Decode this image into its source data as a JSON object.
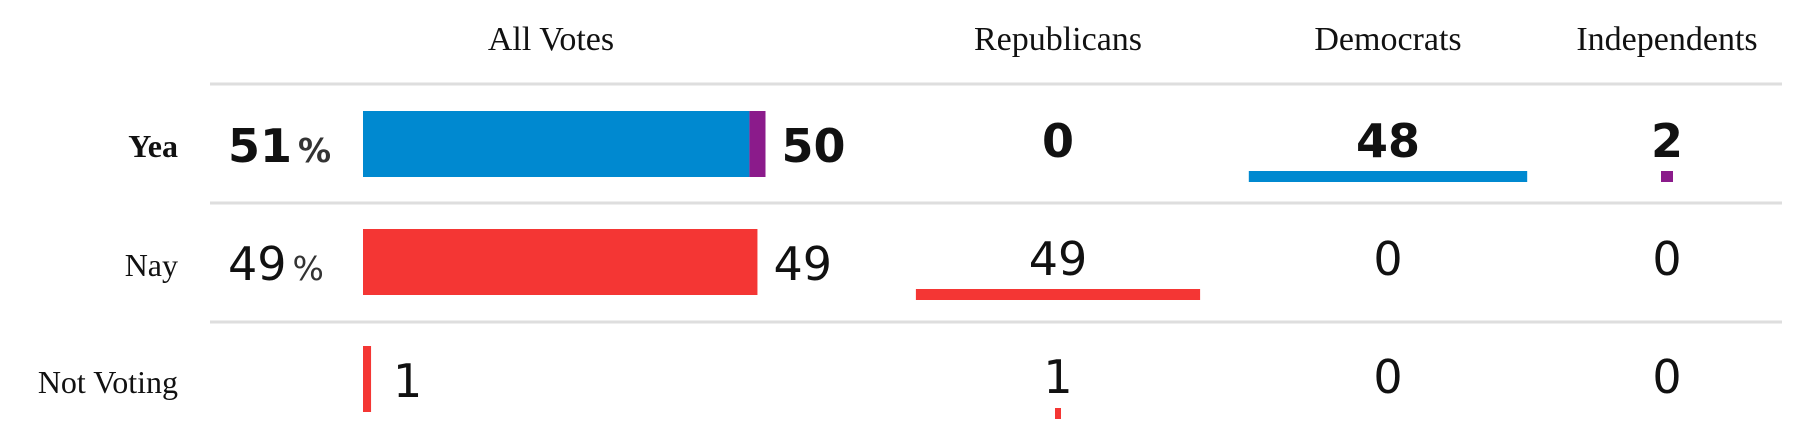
{
  "headers": {
    "all_votes": "All Votes",
    "republicans": "Republicans",
    "democrats": "Democrats",
    "independents": "Independents"
  },
  "percent_sign": "%",
  "colors": {
    "democrat": "#0089d0",
    "republican": "#f43634",
    "independent": "#8b1b8b",
    "divider": "#dedede",
    "text": "#111111"
  },
  "chart_data": {
    "type": "bar",
    "categories": [
      "Yea",
      "Nay",
      "Not Voting"
    ],
    "groups": [
      "Republicans",
      "Democrats",
      "Independents"
    ],
    "rows": [
      {
        "label": "Yea",
        "percent": "51",
        "total": "50",
        "republicans": "0",
        "democrats": "48",
        "independents": "2",
        "segments": {
          "republicans": 0,
          "democrats": 48,
          "independents": 2
        },
        "bold": true
      },
      {
        "label": "Nay",
        "percent": "49",
        "total": "49",
        "republicans": "49",
        "democrats": "0",
        "independents": "0",
        "segments": {
          "republicans": 49,
          "democrats": 0,
          "independents": 0
        },
        "bold": false
      },
      {
        "label": "Not Voting",
        "percent": "",
        "total": "1",
        "republicans": "1",
        "democrats": "0",
        "independents": "0",
        "segments": {
          "republicans": 1,
          "democrats": 0,
          "independents": 0
        },
        "bold": false
      }
    ]
  }
}
